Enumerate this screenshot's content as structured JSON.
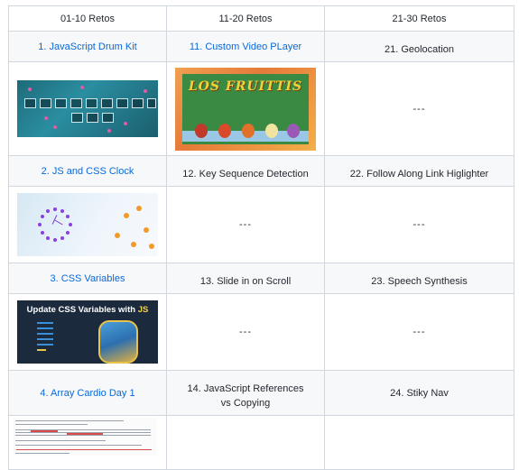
{
  "headers": [
    "01-10 Retos",
    "11-20 Retos",
    "21-30 Retos"
  ],
  "rows": [
    {
      "col1": "1. JavaScript Drum Kit",
      "col2": "11. Custom Video PLayer",
      "col3": "21. Geolocation"
    },
    {
      "col1_image": "drum-kit-thumbnail",
      "col2_image": "los-fruittis-thumbnail",
      "col2_image_text": "LOS FRUITTIS",
      "col3": "---"
    },
    {
      "col1": "2. JS and CSS Clock",
      "col2": "12. Key Sequence Detection",
      "col3": "22. Follow Along Link Higlighter"
    },
    {
      "col1_image": "clock-thumbnail",
      "col2": "---",
      "col3": "---"
    },
    {
      "col1": "3. CSS Variables",
      "col2": "13. Slide in on Scroll",
      "col3": "23. Speech Synthesis"
    },
    {
      "col1_image": "css-variables-thumbnail",
      "col1_image_title": "Update CSS Variables with",
      "col1_image_title_accent": "JS",
      "col2": "---",
      "col3": "---"
    },
    {
      "col1": "4. Array Cardio Day 1",
      "col2": "14. JavaScript References vs Copying",
      "col3": "24. Stiky Nav"
    },
    {
      "col1_image": "array-cardio-thumbnail",
      "col2": "",
      "col3": ""
    }
  ],
  "colors": {
    "link": "#0969da",
    "border": "#d0d7de",
    "row_shade": "#f6f8fa",
    "text": "#24292f"
  }
}
